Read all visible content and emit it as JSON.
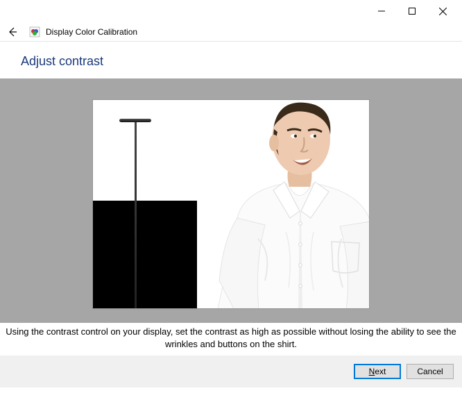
{
  "window": {
    "title": "Display Color Calibration"
  },
  "heading": "Adjust contrast",
  "instruction": "Using the contrast control on your display, set the contrast as high as possible without losing the ability to see the wrinkles and buttons on the shirt.",
  "buttons": {
    "next": "Next",
    "cancel": "Cancel"
  }
}
